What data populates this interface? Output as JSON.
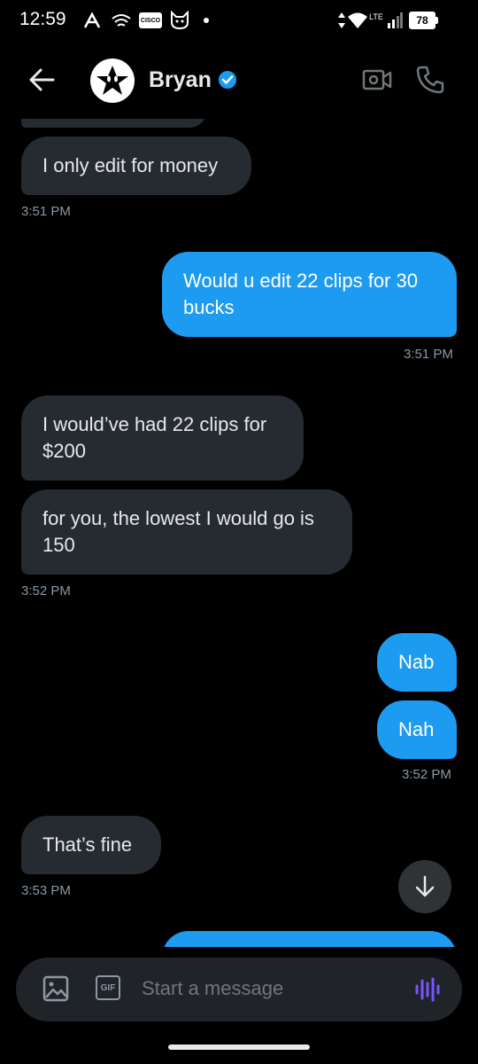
{
  "status_bar": {
    "time": "12:59",
    "lte_label": "LTE",
    "battery": "78",
    "cisco_label": "CISCO"
  },
  "header": {
    "contact_name": "Bryan",
    "accent_color": "#1d9bf0"
  },
  "messages": [
    {
      "id": "m1",
      "direction": "incoming",
      "text": "I only edit for money"
    },
    {
      "id": "t1",
      "direction": "incoming",
      "timestamp": "3:51 PM"
    },
    {
      "id": "m2",
      "direction": "outgoing",
      "text": "Would u edit 22 clips for 30 bucks"
    },
    {
      "id": "t2",
      "direction": "outgoing",
      "timestamp": "3:51 PM"
    },
    {
      "id": "m3",
      "direction": "incoming",
      "text": "I would’ve had 22 clips for $200"
    },
    {
      "id": "m4",
      "direction": "incoming",
      "text": "for you, the lowest I would go is 150"
    },
    {
      "id": "t3",
      "direction": "incoming",
      "timestamp": "3:52 PM"
    },
    {
      "id": "m5",
      "direction": "outgoing",
      "text": "Nab"
    },
    {
      "id": "m6",
      "direction": "outgoing",
      "text": "Nah"
    },
    {
      "id": "t4",
      "direction": "outgoing",
      "timestamp": "3:52 PM"
    },
    {
      "id": "m7",
      "direction": "incoming",
      "text": "That’s fine"
    },
    {
      "id": "t5",
      "direction": "incoming",
      "timestamp": "3:53 PM"
    }
  ],
  "composer": {
    "placeholder": "Start a message",
    "gif_label": "GIF",
    "voice_color": "#7856ff"
  }
}
